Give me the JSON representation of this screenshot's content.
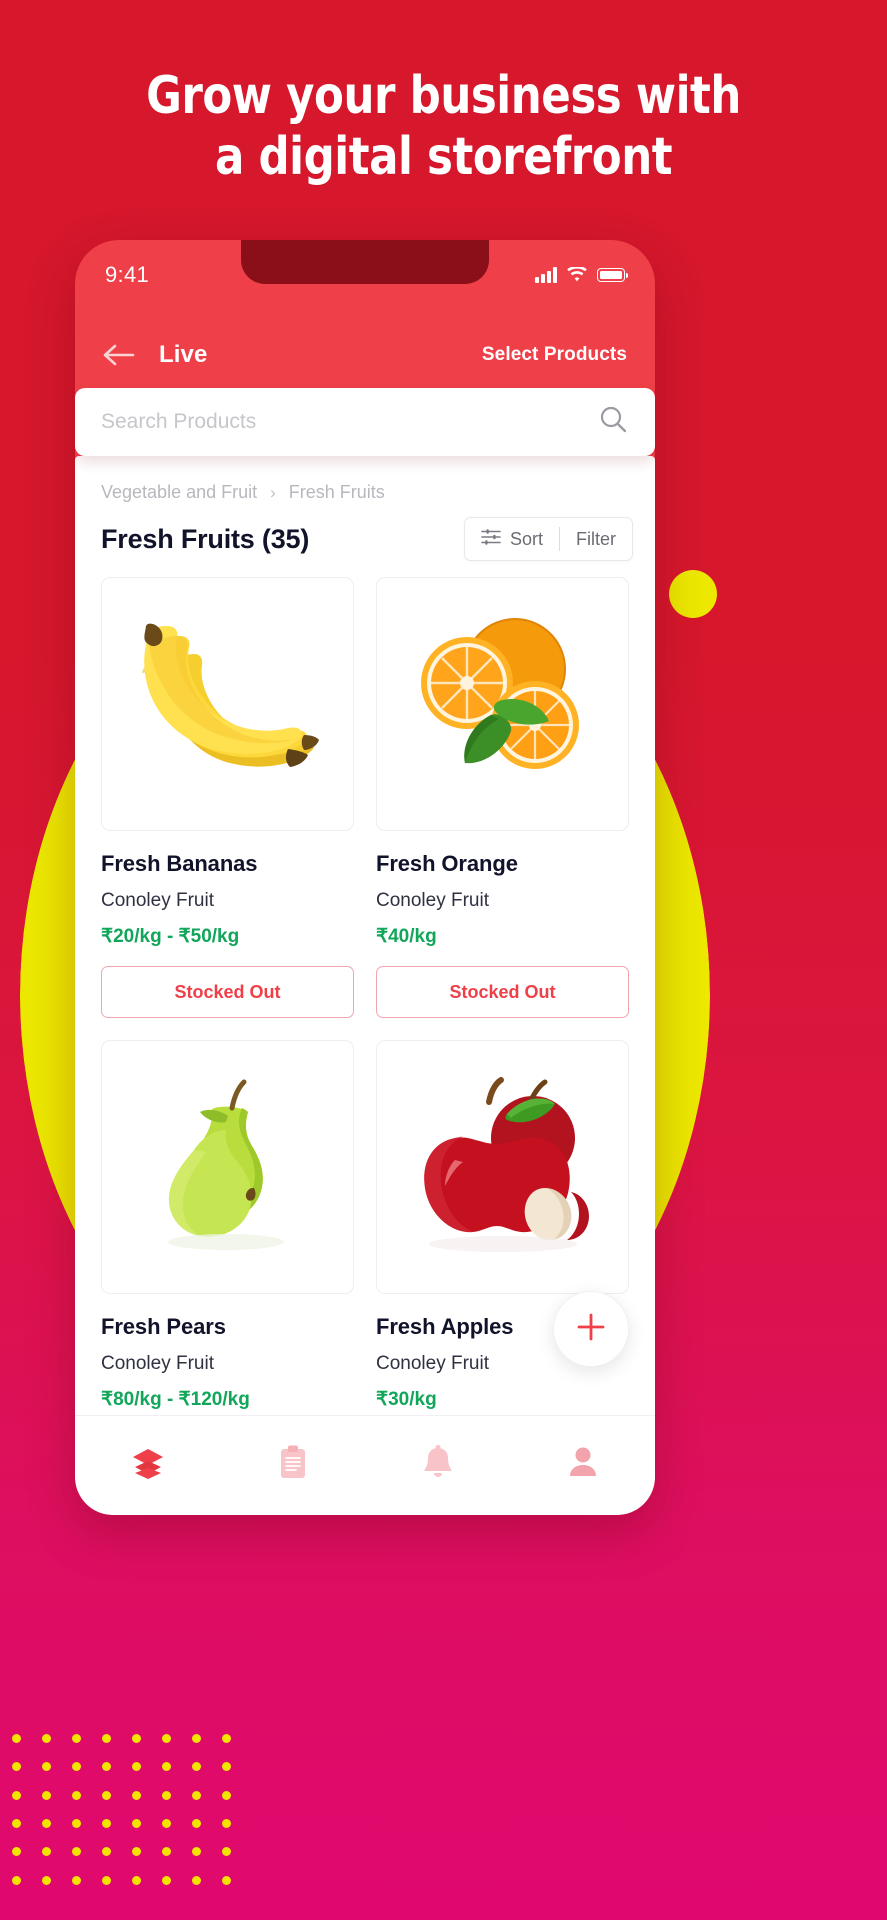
{
  "hero": {
    "headline_line1": "Grow your business with",
    "headline_line2": "a digital storefront"
  },
  "phone": {
    "status": {
      "time": "9:41",
      "signal_icon": "cellular-signal-icon",
      "wifi_icon": "wifi-icon",
      "battery_icon": "battery-full-icon"
    },
    "nav": {
      "back_icon": "back-arrow-icon",
      "title": "Live",
      "action": "Select Products"
    },
    "search": {
      "placeholder": "Search Products",
      "icon": "search-icon"
    },
    "breadcrumb": {
      "parent": "Vegetable and Fruit",
      "separator": "›",
      "current": "Fresh Fruits"
    },
    "listing": {
      "title": "Fresh Fruits (35)",
      "sort_label": "Sort",
      "filter_label": "Filter",
      "sort_icon": "sliders-icon"
    },
    "products": [
      {
        "name": "Fresh Bananas",
        "vendor": "Conoley Fruit",
        "price": "₹20/kg - ₹50/kg",
        "action": "Stocked Out",
        "image": "bananas-image"
      },
      {
        "name": "Fresh Orange",
        "vendor": "Conoley Fruit",
        "price": "₹40/kg",
        "action": "Stocked Out",
        "image": "oranges-image"
      },
      {
        "name": "Fresh Pears",
        "vendor": "Conoley Fruit",
        "price": "₹80/kg - ₹120/kg",
        "action": "",
        "image": "pears-image"
      },
      {
        "name": "Fresh Apples",
        "vendor": "Conoley Fruit",
        "price": "₹30/kg",
        "action": "",
        "image": "apples-image"
      }
    ],
    "fab": {
      "icon": "plus-icon"
    },
    "tabs": [
      {
        "icon": "layers-icon",
        "active": true
      },
      {
        "icon": "clipboard-icon",
        "active": false
      },
      {
        "icon": "bell-icon",
        "active": false
      },
      {
        "icon": "person-icon",
        "active": false
      }
    ]
  },
  "colors": {
    "brand_red": "#d6172c",
    "phone_red": "#ef4049",
    "notch_dark": "#8a0f18",
    "yellow": "#ece800",
    "magenta": "#e0086f",
    "price_green": "#12a65b",
    "text_dark": "#10132a"
  }
}
